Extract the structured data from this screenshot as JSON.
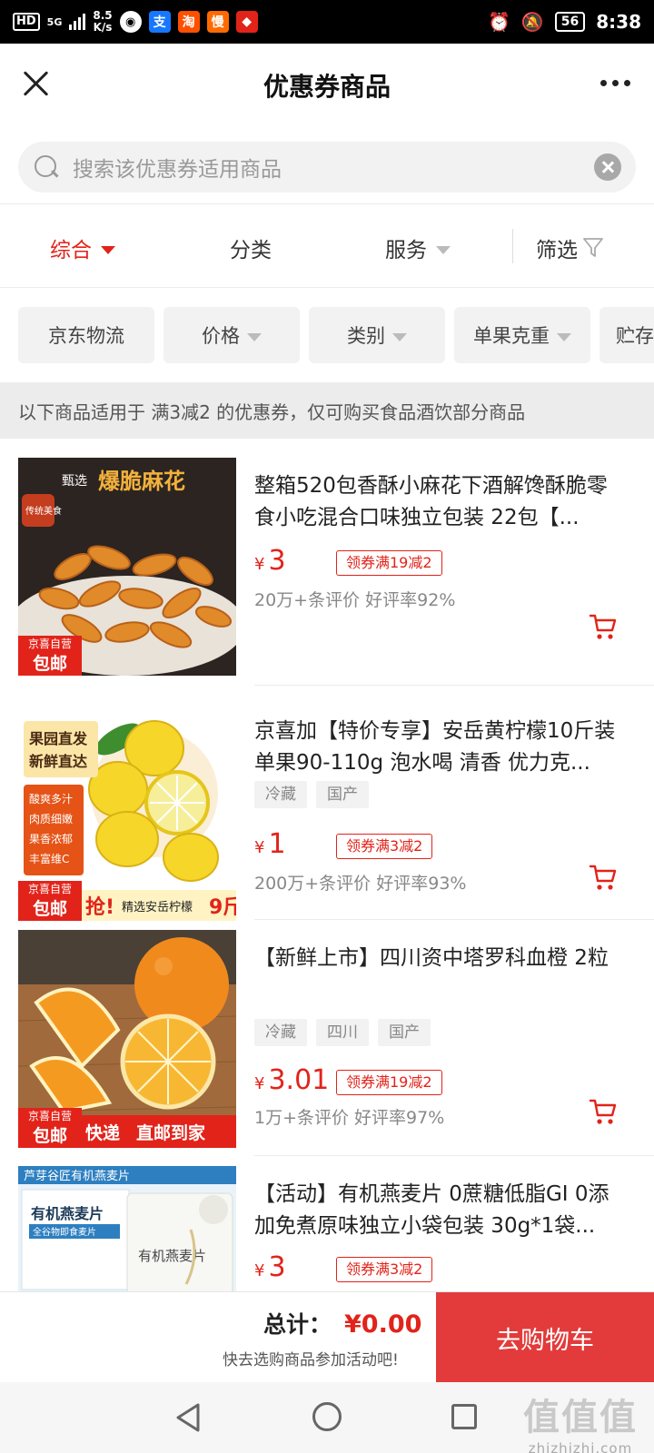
{
  "status_bar": {
    "network": "HD",
    "network_gen": "5G",
    "speed": "8.5",
    "speed_unit": "K/s",
    "battery": "56",
    "time": "8:38"
  },
  "header": {
    "title": "优惠券商品"
  },
  "search": {
    "placeholder": "搜索该优惠券适用商品"
  },
  "sort_tabs": [
    {
      "label": "综合",
      "active": true
    },
    {
      "label": "分类"
    },
    {
      "label": "服务"
    },
    {
      "label": "筛选"
    }
  ],
  "filter_chips": [
    "京东物流",
    "价格",
    "类别",
    "单果克重",
    "贮存"
  ],
  "notice": "以下商品适用于 满3减2 的优惠券，仅可购买食品酒饮部分商品",
  "products": [
    {
      "name": "整箱520包香酥小麻花下酒解馋酥脆零食小吃混合口味独立包装 22包【...",
      "tags": [],
      "price": "3",
      "coupon": "领券满19减2",
      "rating": "20万+条评价 好评率92%",
      "image_text": {
        "a": "甄选",
        "b": "爆脆麻花",
        "c": "传统美食"
      },
      "badge": {
        "top": "京喜自营",
        "bottom": "包邮"
      }
    },
    {
      "name": "京喜加【特价专享】安岳黄柠檬10斤装单果90-110g 泡水喝 清香 优力克...",
      "tags": [
        "冷藏",
        "国产"
      ],
      "price": "1",
      "coupon": "领券满3减2",
      "rating": "200万+条评价 好评率93%",
      "image_text": {
        "a": "果园直发",
        "b": "新鲜直达",
        "c": "酸爽多汁",
        "d": "肉质细嫩",
        "e": "果香浓郁",
        "f": "丰富维C",
        "g": "抢!",
        "h": "精选安岳柠檬",
        "i": "9斤"
      },
      "badge": {
        "top": "京喜自营",
        "bottom": "包邮"
      }
    },
    {
      "name": "【新鲜上市】四川资中塔罗科血橙 2粒",
      "tags": [
        "冷藏",
        "四川",
        "国产"
      ],
      "price": "3.01",
      "coupon": "领券满19减2",
      "rating": "1万+条评价 好评率97%",
      "image_text": {
        "a": "快递",
        "b": "直邮到家"
      },
      "badge": {
        "top": "京喜自营",
        "bottom": "包邮"
      }
    },
    {
      "name": "【活动】有机燕麦片 0蔗糖低脂GI 0添加免煮原味独立小袋包装 30g*1袋...",
      "tags": [],
      "price": "3",
      "coupon": "领券满3减2",
      "rating": "",
      "image_text": {
        "a": "芦芽谷匠有机燕麦片",
        "b": "有机燕麦片",
        "c": "全谷物即食麦片",
        "d": "有机燕麦片"
      },
      "badge": null
    }
  ],
  "bottom_bar": {
    "total_label": "总计：",
    "total_amount": "¥0.00",
    "hint": "快去选购商品参加活动吧!",
    "go_cart": "去购物车"
  },
  "watermark": {
    "line1": "值值值",
    "line2": "zhizhizhi.com"
  },
  "colors": {
    "accent": "#e2231a",
    "button": "#e33b3b"
  }
}
